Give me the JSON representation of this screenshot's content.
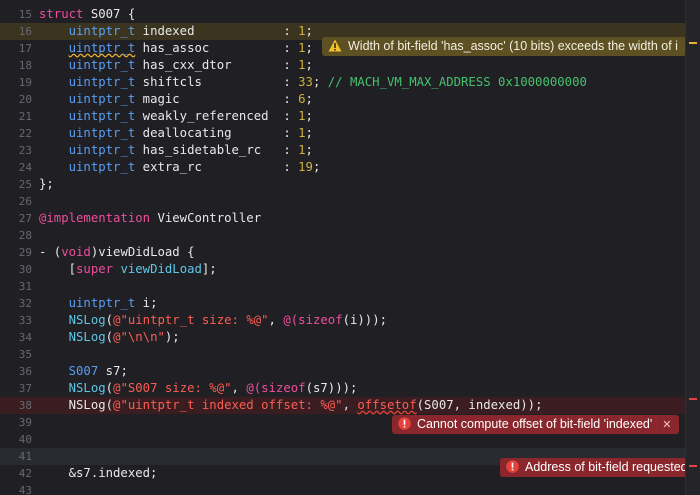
{
  "editor": {
    "language": "Objective-C",
    "accent_colors": {
      "keyword": "#ee4e9e",
      "type": "#5a9ef2",
      "string": "#fc5d54",
      "number": "#cdb33d",
      "comment": "#46c26e",
      "method": "#5ec7e8"
    },
    "lines": [
      {
        "n": "15",
        "parts": [
          {
            "t": "struct",
            "c": "kw"
          },
          {
            "t": " S007 {"
          }
        ]
      },
      {
        "n": "16",
        "parts": [
          {
            "t": "    "
          },
          {
            "t": "uintptr_t",
            "c": "ty"
          },
          {
            "t": " indexed            : "
          },
          {
            "t": "1",
            "c": "nm"
          },
          {
            "t": ";"
          }
        ]
      },
      {
        "n": "17",
        "parts": [
          {
            "t": "    "
          },
          {
            "t": "uintptr_t",
            "c": "ty wsq"
          },
          {
            "t": " has_assoc          : "
          },
          {
            "t": "1",
            "c": "nm"
          },
          {
            "t": ";"
          }
        ]
      },
      {
        "n": "18",
        "parts": [
          {
            "t": "    "
          },
          {
            "t": "uintptr_t",
            "c": "ty"
          },
          {
            "t": " has_cxx_dtor       : "
          },
          {
            "t": "1",
            "c": "nm"
          },
          {
            "t": ";"
          }
        ]
      },
      {
        "n": "19",
        "parts": [
          {
            "t": "    "
          },
          {
            "t": "uintptr_t",
            "c": "ty"
          },
          {
            "t": " shiftcls           : "
          },
          {
            "t": "33",
            "c": "nm"
          },
          {
            "t": "; "
          },
          {
            "t": "// MACH_VM_MAX_ADDRESS 0x1000000000",
            "c": "cm"
          }
        ]
      },
      {
        "n": "20",
        "parts": [
          {
            "t": "    "
          },
          {
            "t": "uintptr_t",
            "c": "ty"
          },
          {
            "t": " magic              : "
          },
          {
            "t": "6",
            "c": "nm"
          },
          {
            "t": ";"
          }
        ]
      },
      {
        "n": "21",
        "parts": [
          {
            "t": "    "
          },
          {
            "t": "uintptr_t",
            "c": "ty"
          },
          {
            "t": " weakly_referenced  : "
          },
          {
            "t": "1",
            "c": "nm"
          },
          {
            "t": ";"
          }
        ]
      },
      {
        "n": "22",
        "parts": [
          {
            "t": "    "
          },
          {
            "t": "uintptr_t",
            "c": "ty"
          },
          {
            "t": " deallocating       : "
          },
          {
            "t": "1",
            "c": "nm"
          },
          {
            "t": ";"
          }
        ]
      },
      {
        "n": "23",
        "parts": [
          {
            "t": "    "
          },
          {
            "t": "uintptr_t",
            "c": "ty"
          },
          {
            "t": " has_sidetable_rc   : "
          },
          {
            "t": "1",
            "c": "nm"
          },
          {
            "t": ";"
          }
        ]
      },
      {
        "n": "24",
        "parts": [
          {
            "t": "    "
          },
          {
            "t": "uintptr_t",
            "c": "ty"
          },
          {
            "t": " extra_rc           : "
          },
          {
            "t": "19",
            "c": "nm"
          },
          {
            "t": ";"
          }
        ]
      },
      {
        "n": "25",
        "parts": [
          {
            "t": "};"
          }
        ]
      },
      {
        "n": "26",
        "parts": []
      },
      {
        "n": "27",
        "parts": [
          {
            "t": "@implementation",
            "c": "kw"
          },
          {
            "t": " ViewController"
          }
        ]
      },
      {
        "n": "28",
        "parts": []
      },
      {
        "n": "29",
        "parts": [
          {
            "t": "- ("
          },
          {
            "t": "void",
            "c": "kw"
          },
          {
            "t": ")viewDidLoad {"
          }
        ]
      },
      {
        "n": "30",
        "parts": [
          {
            "t": "    ["
          },
          {
            "t": "super",
            "c": "kw"
          },
          {
            "t": " "
          },
          {
            "t": "viewDidLoad",
            "c": "mt"
          },
          {
            "t": "];"
          }
        ]
      },
      {
        "n": "31",
        "parts": []
      },
      {
        "n": "32",
        "parts": [
          {
            "t": "    "
          },
          {
            "t": "uintptr_t",
            "c": "ty"
          },
          {
            "t": " i;"
          }
        ]
      },
      {
        "n": "33",
        "parts": [
          {
            "t": "    "
          },
          {
            "t": "NSLog",
            "c": "mt"
          },
          {
            "t": "("
          },
          {
            "t": "@\"uintptr_t size: %@\"",
            "c": "st"
          },
          {
            "t": ", "
          },
          {
            "t": "@(",
            "c": "kw"
          },
          {
            "t": "sizeof",
            "c": "kw"
          },
          {
            "t": "(i)));"
          }
        ]
      },
      {
        "n": "34",
        "parts": [
          {
            "t": "    "
          },
          {
            "t": "NSLog",
            "c": "mt"
          },
          {
            "t": "("
          },
          {
            "t": "@\"\\n\\n\"",
            "c": "st"
          },
          {
            "t": ");"
          }
        ]
      },
      {
        "n": "35",
        "parts": []
      },
      {
        "n": "36",
        "parts": [
          {
            "t": "    "
          },
          {
            "t": "S007",
            "c": "ty"
          },
          {
            "t": " s7;"
          }
        ]
      },
      {
        "n": "37",
        "parts": [
          {
            "t": "    "
          },
          {
            "t": "NSLog",
            "c": "mt"
          },
          {
            "t": "("
          },
          {
            "t": "@\"S007 size: %@\"",
            "c": "st"
          },
          {
            "t": ", "
          },
          {
            "t": "@(",
            "c": "kw"
          },
          {
            "t": "sizeof",
            "c": "kw"
          },
          {
            "t": "(s7)));"
          }
        ]
      },
      {
        "n": "38",
        "parts": [
          {
            "t": "    NSLog("
          },
          {
            "t": "@\"uintptr_t indexed offset: %@\"",
            "c": "st"
          },
          {
            "t": ", "
          },
          {
            "t": "offsetof",
            "c": "st sq"
          },
          {
            "t": "(S007, indexed));"
          }
        ]
      },
      {
        "n": "39",
        "parts": []
      },
      {
        "n": "40",
        "parts": []
      },
      {
        "n": "41",
        "parts": []
      },
      {
        "n": "42",
        "parts": [
          {
            "t": "    &s7.indexed;"
          }
        ]
      },
      {
        "n": "43",
        "parts": []
      }
    ],
    "highlights": {
      "warn": [
        1
      ],
      "err": [
        23
      ],
      "cur": [
        26
      ]
    }
  },
  "diagnostics": {
    "warning": {
      "text": "Width of bit-field 'has_assoc' (10 bits) exceeds the width of i",
      "icon": "warning-icon"
    },
    "error1": {
      "text": "Cannot compute offset of bit-field 'indexed'",
      "icon": "error-icon",
      "close": "✕"
    },
    "error2": {
      "text": "Address of bit-field requested",
      "icon": "error-icon"
    }
  }
}
